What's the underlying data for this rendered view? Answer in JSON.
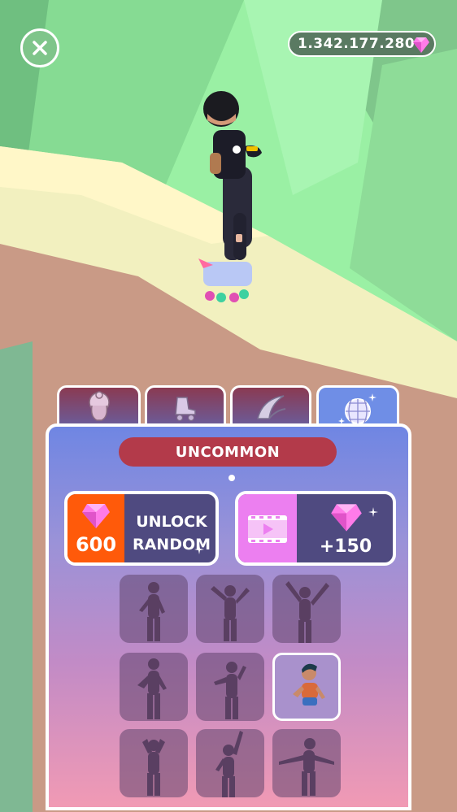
{
  "hud": {
    "gems": "1.342.177.280"
  },
  "tabs": [
    {
      "name": "hair",
      "icon": "hair-icon",
      "active": false
    },
    {
      "name": "skates",
      "icon": "roller-skate-icon",
      "active": false
    },
    {
      "name": "trails",
      "icon": "trail-icon",
      "active": false
    },
    {
      "name": "dances",
      "icon": "disco-ball-icon",
      "active": true
    }
  ],
  "panel": {
    "rarity": "UNCOMMON",
    "unlock": {
      "cost": "600",
      "label_line1": "UNLOCK",
      "label_line2": "RANDOM"
    },
    "video_reward": {
      "amount": "+150"
    }
  },
  "colors": {
    "cost_bg": "#ff5a0a",
    "button_bg": "#4f4a80",
    "video_bg": "#ec7ff0",
    "banner": "#b33a4a",
    "gem": "#ff7be9"
  },
  "dance_slots": [
    {
      "pose": "pose-1",
      "unlocked": false
    },
    {
      "pose": "pose-2",
      "unlocked": false
    },
    {
      "pose": "pose-3",
      "unlocked": false
    },
    {
      "pose": "pose-4",
      "unlocked": false
    },
    {
      "pose": "pose-5",
      "unlocked": false
    },
    {
      "pose": "pose-6",
      "unlocked": true
    },
    {
      "pose": "pose-7",
      "unlocked": false
    },
    {
      "pose": "pose-8",
      "unlocked": false
    },
    {
      "pose": "pose-9",
      "unlocked": false
    }
  ]
}
